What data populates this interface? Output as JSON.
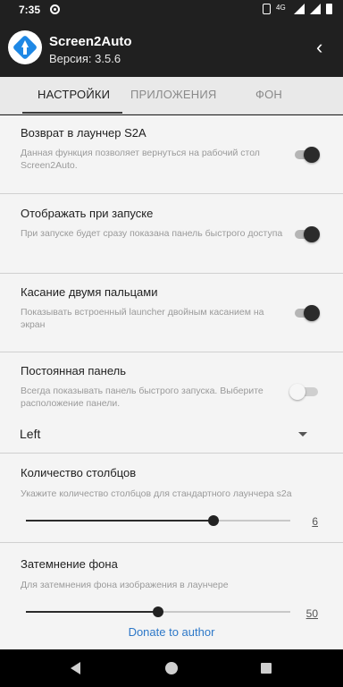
{
  "status": {
    "time": "7:35",
    "network": "4G"
  },
  "app": {
    "title": "Screen2Auto",
    "version": "Версия: 3.5.6"
  },
  "tabs": [
    {
      "label": "НАСТРОЙКИ",
      "active": true
    },
    {
      "label": "ПРИЛОЖЕНИЯ",
      "active": false
    },
    {
      "label": "ФОН",
      "active": false
    }
  ],
  "settings": [
    {
      "title": "Возврат в лаунчер S2A",
      "description": "Данная функция позволяет вернуться на рабочий стол Screen2Auto.",
      "enabled": true
    },
    {
      "title": "Отображать при запуске",
      "description": "При запуске будет сразу показана панель быстрого доступа",
      "enabled": true
    },
    {
      "title": "Касание двумя пальцами",
      "description": "Показывать встроенный launcher двойным касанием на экран",
      "enabled": true
    },
    {
      "title": "Постоянная панель",
      "description": "Всегда показывать панель быстрого запуска. Выберите расположение панели.",
      "enabled": false
    }
  ],
  "panel_position": {
    "value": "Left"
  },
  "columns": {
    "title": "Количество столбцов",
    "description": "Укажите количество столбцов для стандартного лаунчера s2a",
    "value": "6",
    "fraction": 0.71
  },
  "dim": {
    "title": "Затемнение фона",
    "description": "Для затемнения фона изображения в лаунчере",
    "value": "50",
    "fraction": 0.5
  },
  "footer": {
    "donate_label": "Donate to author"
  },
  "colors": {
    "accent_dark": "#2b2b2b",
    "link": "#2d78c8",
    "logo_blue": "#1e88e5"
  }
}
